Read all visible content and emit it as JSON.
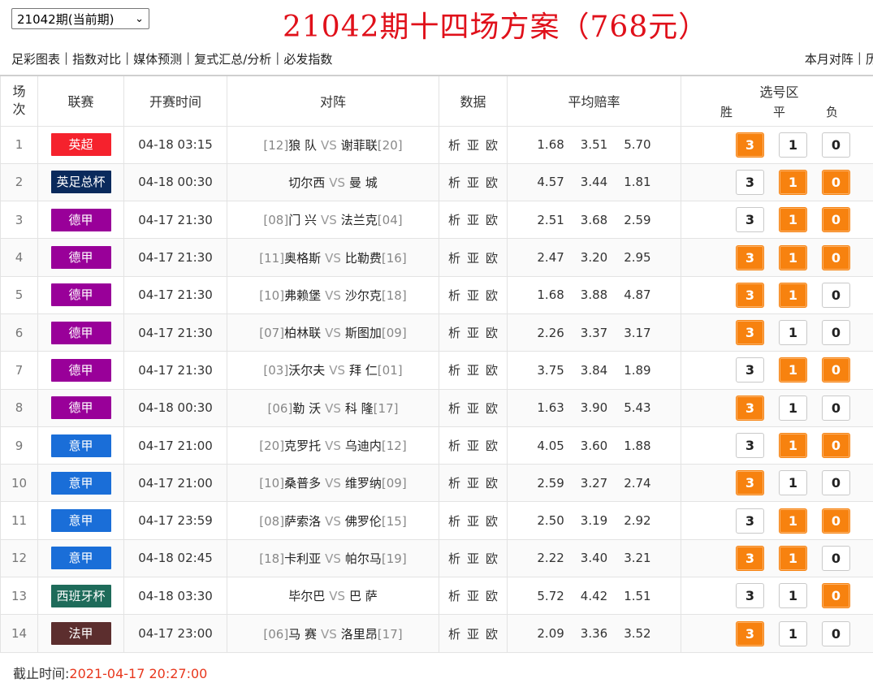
{
  "period_select": {
    "value": "21042期(当前期)"
  },
  "title": "21042期十四场方案（768元）",
  "nav_left": [
    "足彩图表",
    "指数对比",
    "媒体预测",
    "复式汇总/分析",
    "必发指数"
  ],
  "nav_right": [
    "本月对阵",
    "历"
  ],
  "table": {
    "headers": {
      "no": [
        "场",
        "次"
      ],
      "league": "联赛",
      "time": "开赛时间",
      "match": "对阵",
      "data": "数据",
      "odds": "平均赔率",
      "pick_title": "选号区",
      "pick_cols": [
        "胜",
        "平",
        "负"
      ]
    },
    "data_links": [
      "析",
      "亚",
      "欧"
    ],
    "vs": "VS",
    "pick_values": [
      "3",
      "1",
      "0"
    ],
    "rows": [
      {
        "no": "1",
        "league": "英超",
        "league_color": "#f5222d",
        "time": "04-18 03:15",
        "home_rank": "[12]",
        "home": "狼 队",
        "away": "谢菲联",
        "away_rank": "[20]",
        "odds": [
          "1.68",
          "3.51",
          "5.70"
        ],
        "picks": [
          true,
          false,
          false
        ]
      },
      {
        "no": "2",
        "league": "英足总杯",
        "league_color": "#0a2a5c",
        "time": "04-18 00:30",
        "home_rank": "",
        "home": "切尔西",
        "away": "曼 城",
        "away_rank": "",
        "odds": [
          "4.57",
          "3.44",
          "1.81"
        ],
        "picks": [
          false,
          true,
          true
        ]
      },
      {
        "no": "3",
        "league": "德甲",
        "league_color": "#990099",
        "time": "04-17 21:30",
        "home_rank": "[08]",
        "home": "门 兴",
        "away": "法兰克",
        "away_rank": "[04]",
        "odds": [
          "2.51",
          "3.68",
          "2.59"
        ],
        "picks": [
          false,
          true,
          true
        ]
      },
      {
        "no": "4",
        "league": "德甲",
        "league_color": "#990099",
        "time": "04-17 21:30",
        "home_rank": "[11]",
        "home": "奥格斯",
        "away": "比勒费",
        "away_rank": "[16]",
        "odds": [
          "2.47",
          "3.20",
          "2.95"
        ],
        "picks": [
          true,
          true,
          true
        ]
      },
      {
        "no": "5",
        "league": "德甲",
        "league_color": "#990099",
        "time": "04-17 21:30",
        "home_rank": "[10]",
        "home": "弗赖堡",
        "away": "沙尔克",
        "away_rank": "[18]",
        "odds": [
          "1.68",
          "3.88",
          "4.87"
        ],
        "picks": [
          true,
          true,
          false
        ]
      },
      {
        "no": "6",
        "league": "德甲",
        "league_color": "#990099",
        "time": "04-17 21:30",
        "home_rank": "[07]",
        "home": "柏林联",
        "away": "斯图加",
        "away_rank": "[09]",
        "odds": [
          "2.26",
          "3.37",
          "3.17"
        ],
        "picks": [
          true,
          false,
          false
        ]
      },
      {
        "no": "7",
        "league": "德甲",
        "league_color": "#990099",
        "time": "04-17 21:30",
        "home_rank": "[03]",
        "home": "沃尔夫",
        "away": "拜 仁",
        "away_rank": "[01]",
        "odds": [
          "3.75",
          "3.84",
          "1.89"
        ],
        "picks": [
          false,
          true,
          true
        ]
      },
      {
        "no": "8",
        "league": "德甲",
        "league_color": "#990099",
        "time": "04-18 00:30",
        "home_rank": "[06]",
        "home": "勒 沃",
        "away": "科 隆",
        "away_rank": "[17]",
        "odds": [
          "1.63",
          "3.90",
          "5.43"
        ],
        "picks": [
          true,
          false,
          false
        ]
      },
      {
        "no": "9",
        "league": "意甲",
        "league_color": "#1a6ed8",
        "time": "04-17 21:00",
        "home_rank": "[20]",
        "home": "克罗托",
        "away": "乌迪内",
        "away_rank": "[12]",
        "odds": [
          "4.05",
          "3.60",
          "1.88"
        ],
        "picks": [
          false,
          true,
          true
        ]
      },
      {
        "no": "10",
        "league": "意甲",
        "league_color": "#1a6ed8",
        "time": "04-17 21:00",
        "home_rank": "[10]",
        "home": "桑普多",
        "away": "维罗纳",
        "away_rank": "[09]",
        "odds": [
          "2.59",
          "3.27",
          "2.74"
        ],
        "picks": [
          true,
          false,
          false
        ]
      },
      {
        "no": "11",
        "league": "意甲",
        "league_color": "#1a6ed8",
        "time": "04-17 23:59",
        "home_rank": "[08]",
        "home": "萨索洛",
        "away": "佛罗伦",
        "away_rank": "[15]",
        "odds": [
          "2.50",
          "3.19",
          "2.92"
        ],
        "picks": [
          false,
          true,
          true
        ]
      },
      {
        "no": "12",
        "league": "意甲",
        "league_color": "#1a6ed8",
        "time": "04-18 02:45",
        "home_rank": "[18]",
        "home": "卡利亚",
        "away": "帕尔马",
        "away_rank": "[19]",
        "odds": [
          "2.22",
          "3.40",
          "3.21"
        ],
        "picks": [
          true,
          true,
          false
        ]
      },
      {
        "no": "13",
        "league": "西班牙杯",
        "league_color": "#1e6b5a",
        "time": "04-18 03:30",
        "home_rank": "",
        "home": "毕尔巴",
        "away": "巴 萨",
        "away_rank": "",
        "odds": [
          "5.72",
          "4.42",
          "1.51"
        ],
        "picks": [
          false,
          false,
          true
        ]
      },
      {
        "no": "14",
        "league": "法甲",
        "league_color": "#5c2e2e",
        "time": "04-17 23:00",
        "home_rank": "[06]",
        "home": "马 赛",
        "away": "洛里昂",
        "away_rank": "[17]",
        "odds": [
          "2.09",
          "3.36",
          "3.52"
        ],
        "picks": [
          true,
          false,
          false
        ]
      }
    ]
  },
  "footer": {
    "label": "截止时间:",
    "deadline": "2021-04-17 20:27:00"
  },
  "colors": {
    "title": "#e0101a",
    "pick_on": "#f7820f",
    "deadline": "#e8371d"
  }
}
